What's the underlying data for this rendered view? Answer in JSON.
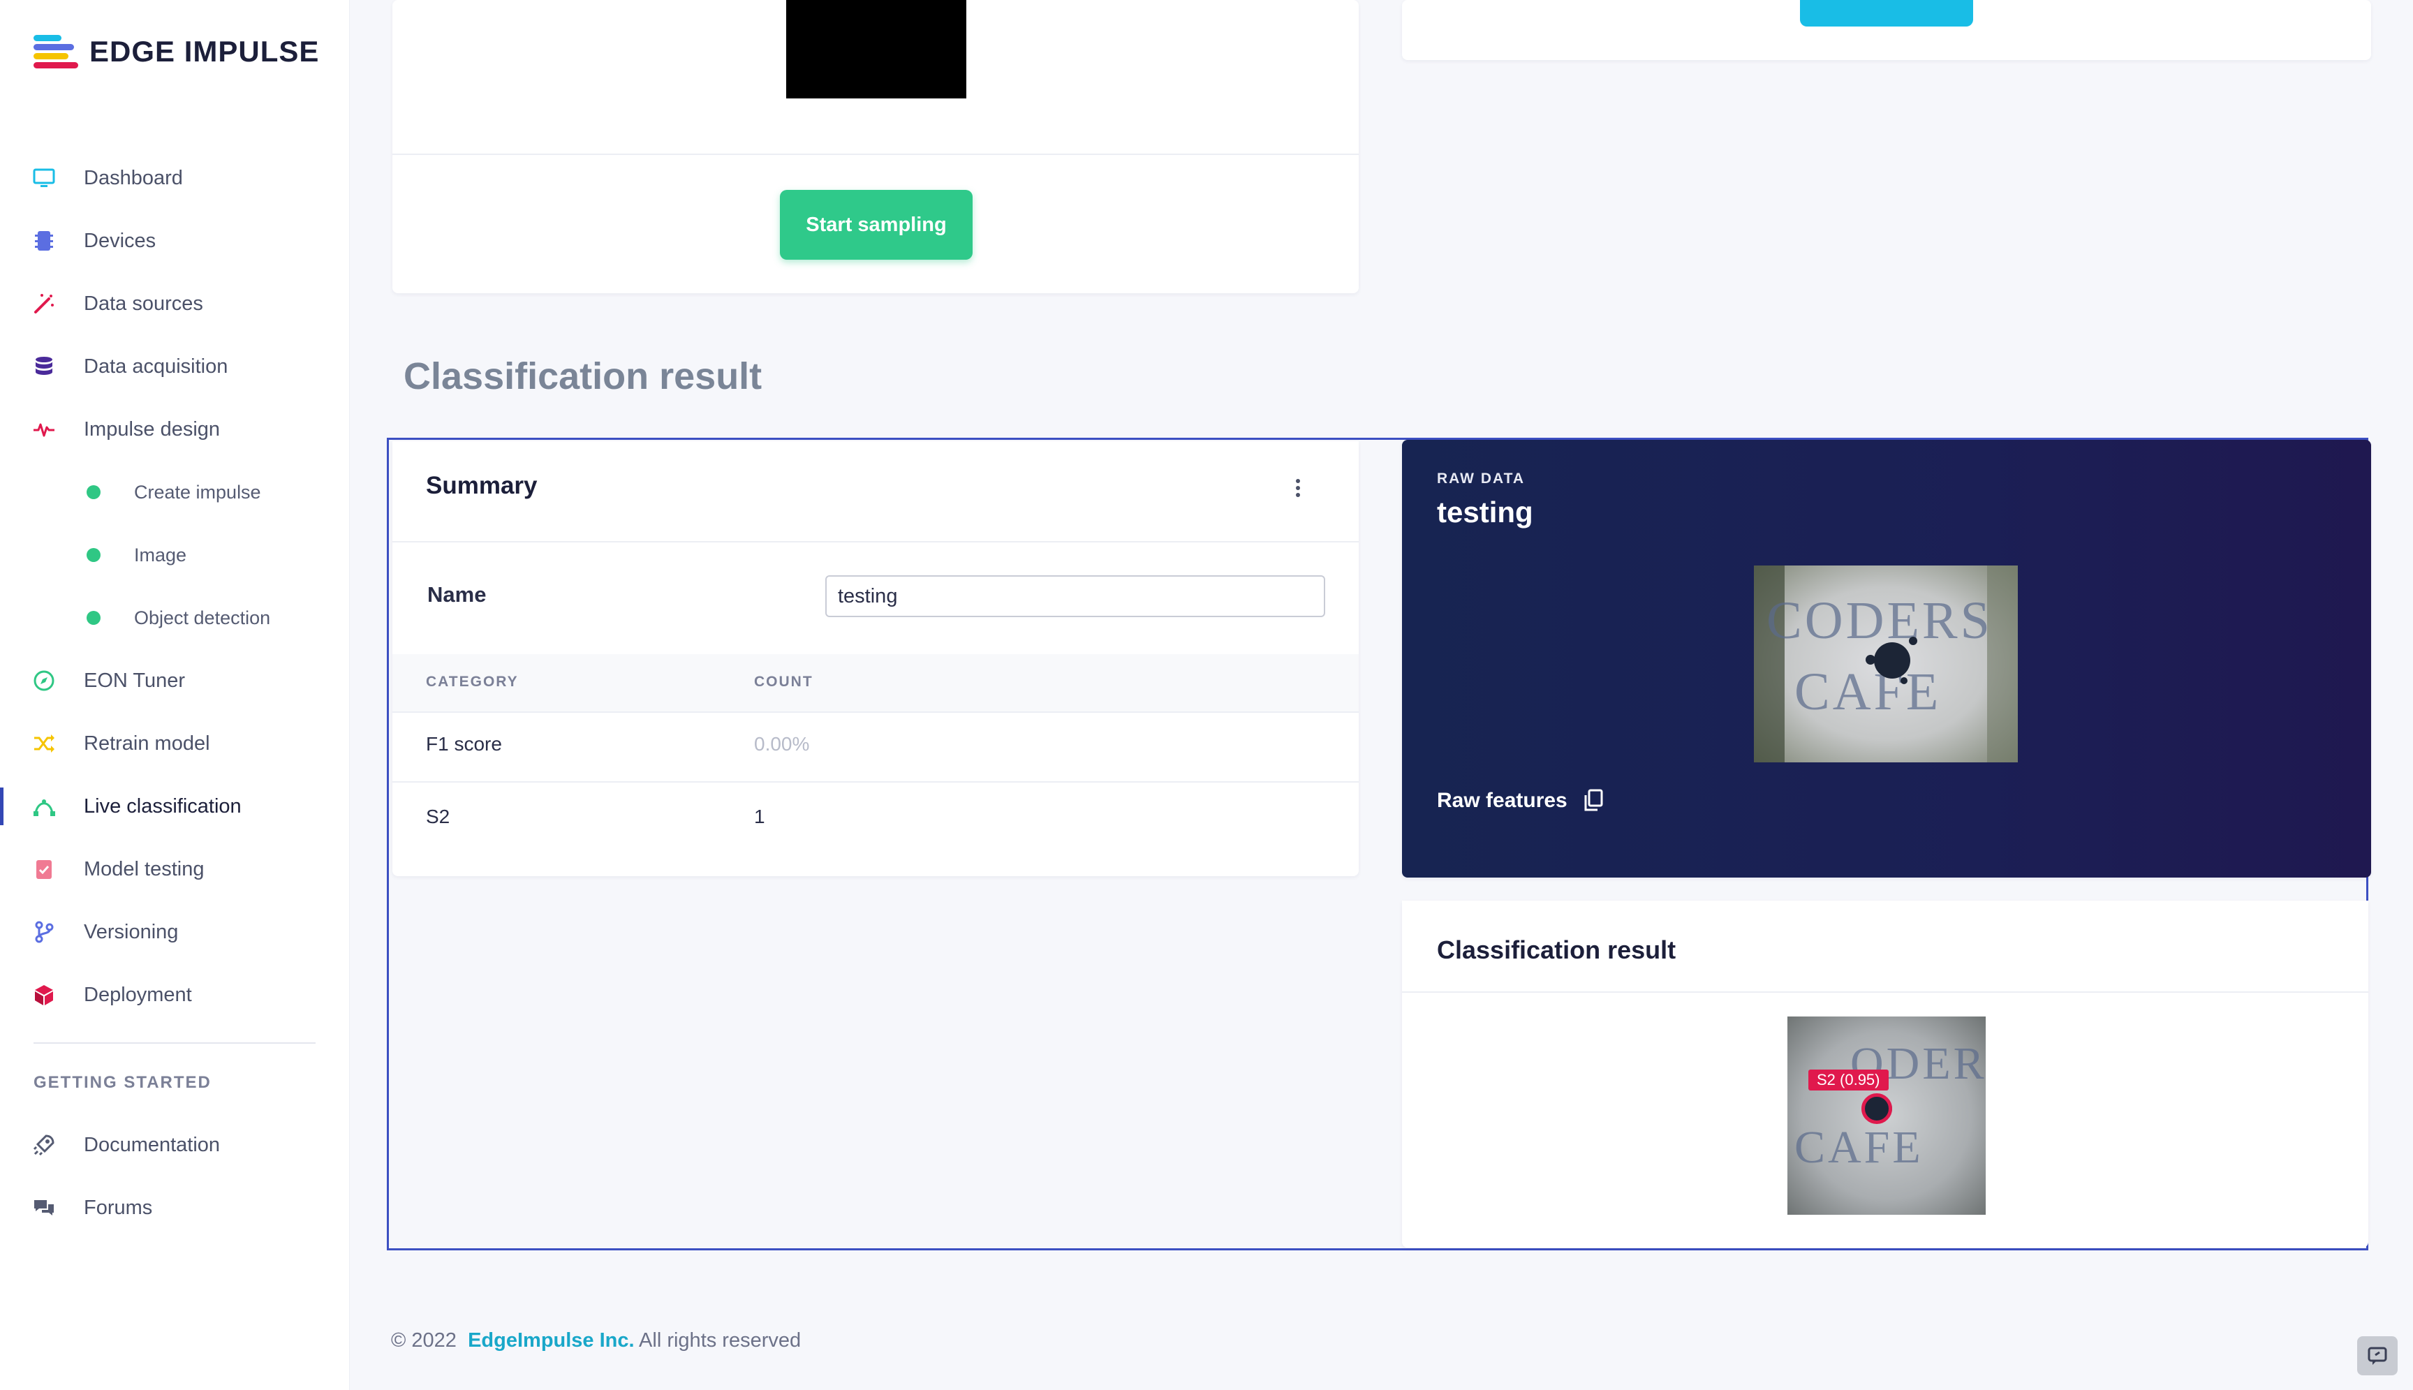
{
  "brand": {
    "name": "EDGE IMPULSE"
  },
  "sidebar": {
    "items": [
      {
        "label": "Dashboard",
        "icon": "monitor-icon",
        "color": "#19bde6"
      },
      {
        "label": "Devices",
        "icon": "chip-icon",
        "color": "#5b6ee1"
      },
      {
        "label": "Data sources",
        "icon": "magic-wand-icon",
        "color": "#e0194d"
      },
      {
        "label": "Data acquisition",
        "icon": "database-icon",
        "color": "#4a2a9a"
      },
      {
        "label": "Impulse design",
        "icon": "pulse-icon",
        "color": "#e0194d"
      },
      {
        "label": "Create impulse",
        "icon": "status-dot-icon",
        "color": "#2fc784"
      },
      {
        "label": "Image",
        "icon": "status-dot-icon",
        "color": "#2fc784"
      },
      {
        "label": "Object detection",
        "icon": "status-dot-icon",
        "color": "#2fc784"
      },
      {
        "label": "EON Tuner",
        "icon": "compass-icon",
        "color": "#2fc784"
      },
      {
        "label": "Retrain model",
        "icon": "shuffle-icon",
        "color": "#f5c400"
      },
      {
        "label": "Live classification",
        "icon": "bezier-icon",
        "color": "#2fc784"
      },
      {
        "label": "Model testing",
        "icon": "clipboard-check-icon",
        "color": "#f07a93"
      },
      {
        "label": "Versioning",
        "icon": "git-branch-icon",
        "color": "#5b6ee1"
      },
      {
        "label": "Deployment",
        "icon": "cube-icon",
        "color": "#e0194d"
      }
    ],
    "getting_started_title": "GETTING STARTED",
    "getting_started": [
      {
        "label": "Documentation",
        "icon": "rocket-icon"
      },
      {
        "label": "Forums",
        "icon": "chat-bubbles-icon"
      }
    ]
  },
  "sampling": {
    "start_label": "Start sampling"
  },
  "section_title": "Classification result",
  "summary": {
    "title": "Summary",
    "name_label": "Name",
    "name_value": "testing",
    "columns": [
      "CATEGORY",
      "COUNT"
    ],
    "rows": [
      {
        "category": "F1 score",
        "count": "0.00%"
      },
      {
        "category": "S2",
        "count": "1"
      }
    ]
  },
  "raw_data": {
    "kicker": "RAW DATA",
    "name": "testing",
    "features_label": "Raw features",
    "image_text_line1": "CODERS",
    "image_text_line2": "CAFE"
  },
  "classification": {
    "title": "Classification result",
    "box_label": "S2 (0.95)",
    "image_text_line1": "ODERS",
    "image_text_line2": "CAFE",
    "box_color": "#e0194d"
  },
  "footer": {
    "copyright": "© 2022",
    "company": "EdgeImpulse Inc.",
    "rights": "All rights reserved"
  },
  "colors": {
    "accent_green": "#2fc98a",
    "accent_cyan": "#19bde6",
    "frame_blue": "#3c4fc2",
    "raw_panel": "#1b1f55"
  }
}
